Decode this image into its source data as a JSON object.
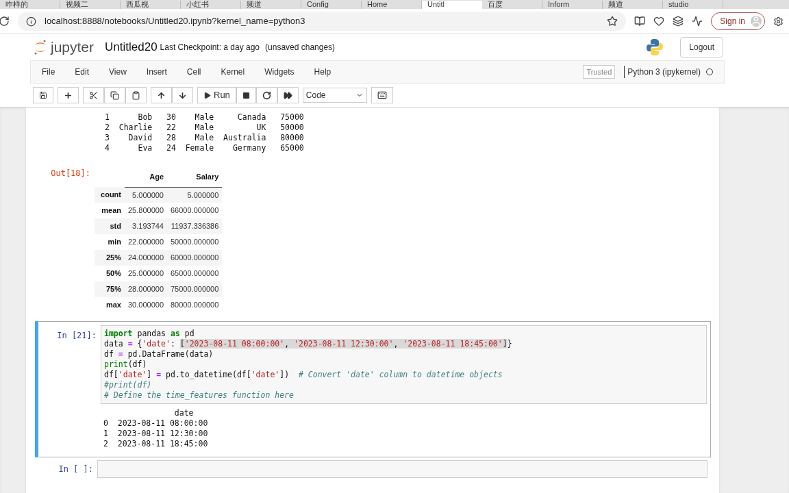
{
  "browser": {
    "tabs": [
      {
        "label": "咋样的",
        "selected": false
      },
      {
        "label": "视频二",
        "selected": false
      },
      {
        "label": "西瓜视",
        "selected": false
      },
      {
        "label": "小红书",
        "selected": false
      },
      {
        "label": "频道",
        "selected": false
      },
      {
        "label": "Config",
        "selected": false
      },
      {
        "label": "Home",
        "selected": false
      },
      {
        "label": "Untitl",
        "selected": true
      },
      {
        "label": "百度",
        "selected": false
      },
      {
        "label": "Inform",
        "selected": false
      },
      {
        "label": "频道",
        "selected": false
      },
      {
        "label": "studio",
        "selected": false
      }
    ],
    "url": "localhost:8888/notebooks/Untitled20.ipynb?kernel_name=python3",
    "sign_in": "Sign in"
  },
  "header": {
    "logo": "jupyter",
    "notebook_name": "Untitled20",
    "checkpoint": "Last Checkpoint: a day ago",
    "unsaved": "(unsaved changes)",
    "logout": "Logout"
  },
  "menu": [
    "File",
    "Edit",
    "View",
    "Insert",
    "Cell",
    "Kernel",
    "Widgets",
    "Help"
  ],
  "trusted": "Trusted",
  "kernel": "Python 3 (ipykernel)",
  "toolbar": {
    "run": "Run",
    "cell_type": "Code"
  },
  "printed_df": [
    "1      Bob   30    Male     Canada   75000",
    "2  Charlie   22    Male         UK   50000",
    "3    David   28    Male  Australia   80000",
    "4      Eva   24  Female    Germany   65000"
  ],
  "out_prompt": "Out[18]:",
  "describe": {
    "columns": [
      "Age",
      "Salary"
    ],
    "rows": [
      {
        "label": "count",
        "values": [
          "5.000000",
          "5.000000"
        ]
      },
      {
        "label": "mean",
        "values": [
          "25.800000",
          "66000.000000"
        ]
      },
      {
        "label": "std",
        "values": [
          "3.193744",
          "11937.336386"
        ]
      },
      {
        "label": "min",
        "values": [
          "22.000000",
          "50000.000000"
        ]
      },
      {
        "label": "25%",
        "values": [
          "24.000000",
          "60000.000000"
        ]
      },
      {
        "label": "50%",
        "values": [
          "25.000000",
          "65000.000000"
        ]
      },
      {
        "label": "75%",
        "values": [
          "28.000000",
          "75000.000000"
        ]
      },
      {
        "label": "max",
        "values": [
          "30.000000",
          "80000.000000"
        ]
      }
    ]
  },
  "cell": {
    "prompt": "In [21]:",
    "selected": true,
    "code": [
      [
        {
          "t": "import",
          "kind": "kw"
        },
        {
          "t": " pandas ",
          "kind": "plain"
        },
        {
          "t": "as",
          "kind": "kw"
        },
        {
          "t": " pd",
          "kind": "plain"
        }
      ],
      [
        {
          "t": "data ",
          "kind": "plain",
          "selected": false
        },
        {
          "t": "=",
          "kind": "op",
          "selected": false
        },
        {
          "t": " {",
          "kind": "plain",
          "selected": false
        },
        {
          "t": "'date'",
          "kind": "str",
          "selected": false
        },
        {
          "t": ": ",
          "kind": "plain",
          "selected": false
        },
        {
          "t": "[",
          "kind": "plain",
          "selected": true
        },
        {
          "t": "'2023-08-11 08:00:00'",
          "kind": "str",
          "selected": true
        },
        {
          "t": ", ",
          "kind": "plain",
          "selected": true
        },
        {
          "t": "'2023-08-11 12:30:00'",
          "kind": "str",
          "selected": true
        },
        {
          "t": ", ",
          "kind": "plain",
          "selected": true
        },
        {
          "t": "'2023-08-11 18:45:00'",
          "kind": "str",
          "selected": true
        },
        {
          "t": "]",
          "kind": "plain",
          "selected": true
        },
        {
          "t": "}",
          "kind": "plain",
          "selected": false
        }
      ],
      [
        {
          "t": "df ",
          "kind": "plain"
        },
        {
          "t": "=",
          "kind": "op"
        },
        {
          "t": " pd.DataFrame(data)",
          "kind": "plain"
        }
      ],
      [
        {
          "t": "print",
          "kind": "builtin"
        },
        {
          "t": "(df)",
          "kind": "plain"
        }
      ],
      [
        {
          "t": "df[",
          "kind": "plain"
        },
        {
          "t": "'date'",
          "kind": "str"
        },
        {
          "t": "] ",
          "kind": "plain"
        },
        {
          "t": "=",
          "kind": "op"
        },
        {
          "t": " pd.to_datetime(df[",
          "kind": "plain"
        },
        {
          "t": "'date'",
          "kind": "str"
        },
        {
          "t": "])  ",
          "kind": "plain"
        },
        {
          "t": "# Convert 'date' column to datetime objects",
          "kind": "comment"
        }
      ],
      [
        {
          "t": "#print(df)",
          "kind": "comment"
        }
      ],
      [
        {
          "t": "# Define the time_features function here",
          "kind": "comment"
        }
      ]
    ],
    "output": [
      "               date",
      "0  2023-08-11 08:00:00",
      "1  2023-08-11 12:30:00",
      "2  2023-08-11 18:45:00"
    ]
  },
  "empty_cell": {
    "prompt": "In [ ]:"
  }
}
